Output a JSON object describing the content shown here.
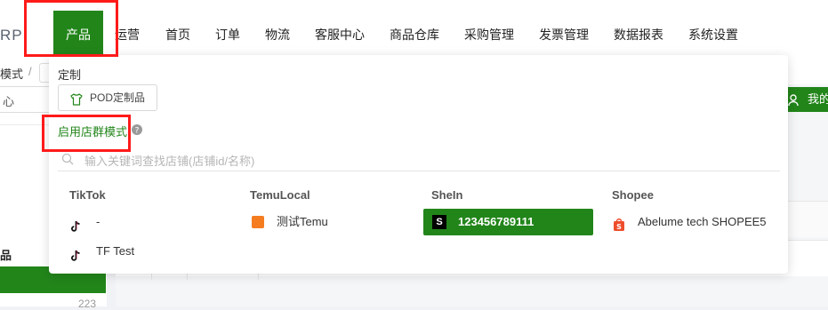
{
  "app": {
    "logo_text": "RP"
  },
  "nav": {
    "items": [
      {
        "label": "产品",
        "active": true
      },
      {
        "label": "运营"
      },
      {
        "label": "首页"
      },
      {
        "label": "订单"
      },
      {
        "label": "物流"
      },
      {
        "label": "客服中心"
      },
      {
        "label": "商品仓库"
      },
      {
        "label": "采购管理"
      },
      {
        "label": "发票管理"
      },
      {
        "label": "数据报表"
      },
      {
        "label": "系统设置"
      }
    ]
  },
  "background": {
    "breadcrumb_fragment": "模式",
    "breadcrumb_sep": "/",
    "left_input_fragment": "心",
    "left_label_fragment": "品",
    "left_number": "223",
    "right_button_fragment": "我的"
  },
  "dropdown": {
    "custom_section_title": "定制",
    "pod_button_label": "POD定制品",
    "group_mode_label": "启用店群模式",
    "help_icon": "question-circle-icon",
    "search_placeholder": "输入关键词查找店铺(店铺id/名称)",
    "columns": [
      {
        "title": "TikTok",
        "stores": [
          "-",
          "TF Test"
        ]
      },
      {
        "title": "TemuLocal",
        "stores": [
          "测试Temu"
        ]
      },
      {
        "title": "SheIn",
        "stores": [
          "123456789111"
        ],
        "selected_index": 0
      },
      {
        "title": "Shopee",
        "stores": [
          "Abelume tech SHOPEE5"
        ]
      }
    ]
  },
  "colors": {
    "accent_green": "#22851a",
    "highlight_red": "#ff1a1a",
    "shopee_orange": "#ee4d2d",
    "temu_orange": "#f57c1f"
  }
}
